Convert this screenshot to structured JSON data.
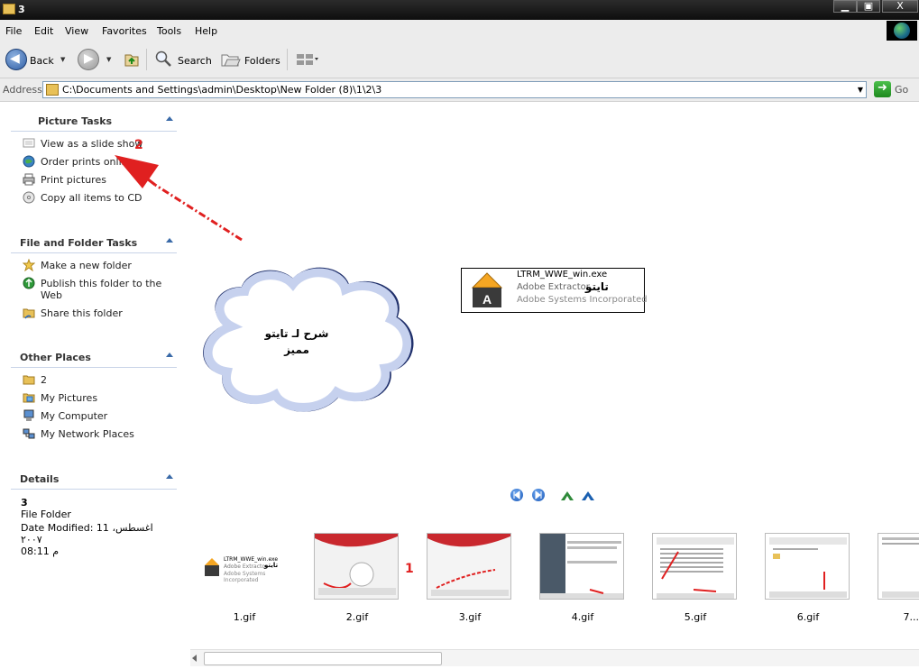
{
  "window": {
    "title": "3",
    "min_label": "▁",
    "max_label": "▣",
    "close_label": "X"
  },
  "menu": {
    "items": [
      "File",
      "Edit",
      "View",
      "Favorites",
      "Tools",
      "Help"
    ]
  },
  "toolbar": {
    "back_label": "Back",
    "search_label": "Search",
    "folders_label": "Folders"
  },
  "address": {
    "label": "Address",
    "value": "C:\\Documents and Settings\\admin\\Desktop\\New Folder (8)\\1\\2\\3",
    "go_label": "Go"
  },
  "picture_tasks": {
    "title": "Picture Tasks",
    "items": [
      "View as a slide show",
      "Order prints online",
      "Print pictures",
      "Copy all items to CD"
    ]
  },
  "file_folder_tasks": {
    "title": "File and Folder Tasks",
    "items": [
      "Make a new folder",
      "Publish this folder to the Web",
      "Share this folder"
    ]
  },
  "other_places": {
    "title": "Other Places",
    "items": [
      "2",
      "My Pictures",
      "My Computer",
      "My Network Places"
    ]
  },
  "details": {
    "title": "Details",
    "name": "3",
    "type": "File Folder",
    "modified": "Date Modified: 11 اغسطس، ٢٠٠٧",
    "time": "08:11 م"
  },
  "preview": {
    "filename": "LTRM_WWE_win.exe",
    "line2": "Adobe Extractor",
    "line3": "Adobe Systems Incorporated",
    "overlay": "تايتو"
  },
  "cloud": {
    "line1": "شرح لـ تايتو",
    "line2": "مميز"
  },
  "annotations": {
    "num1": "1",
    "num2": "2"
  },
  "thumbnails": [
    {
      "label": "1.gif"
    },
    {
      "label": "2.gif"
    },
    {
      "label": "3.gif"
    },
    {
      "label": "4.gif"
    },
    {
      "label": "5.gif"
    },
    {
      "label": "6.gif"
    },
    {
      "label": "7..."
    }
  ],
  "thumb1": {
    "filename": "LTRM_WWE_win.exe",
    "line2": "Adobe Extractor",
    "line3": "Adobe Systems Incorporated",
    "overlay": "تايتو"
  }
}
